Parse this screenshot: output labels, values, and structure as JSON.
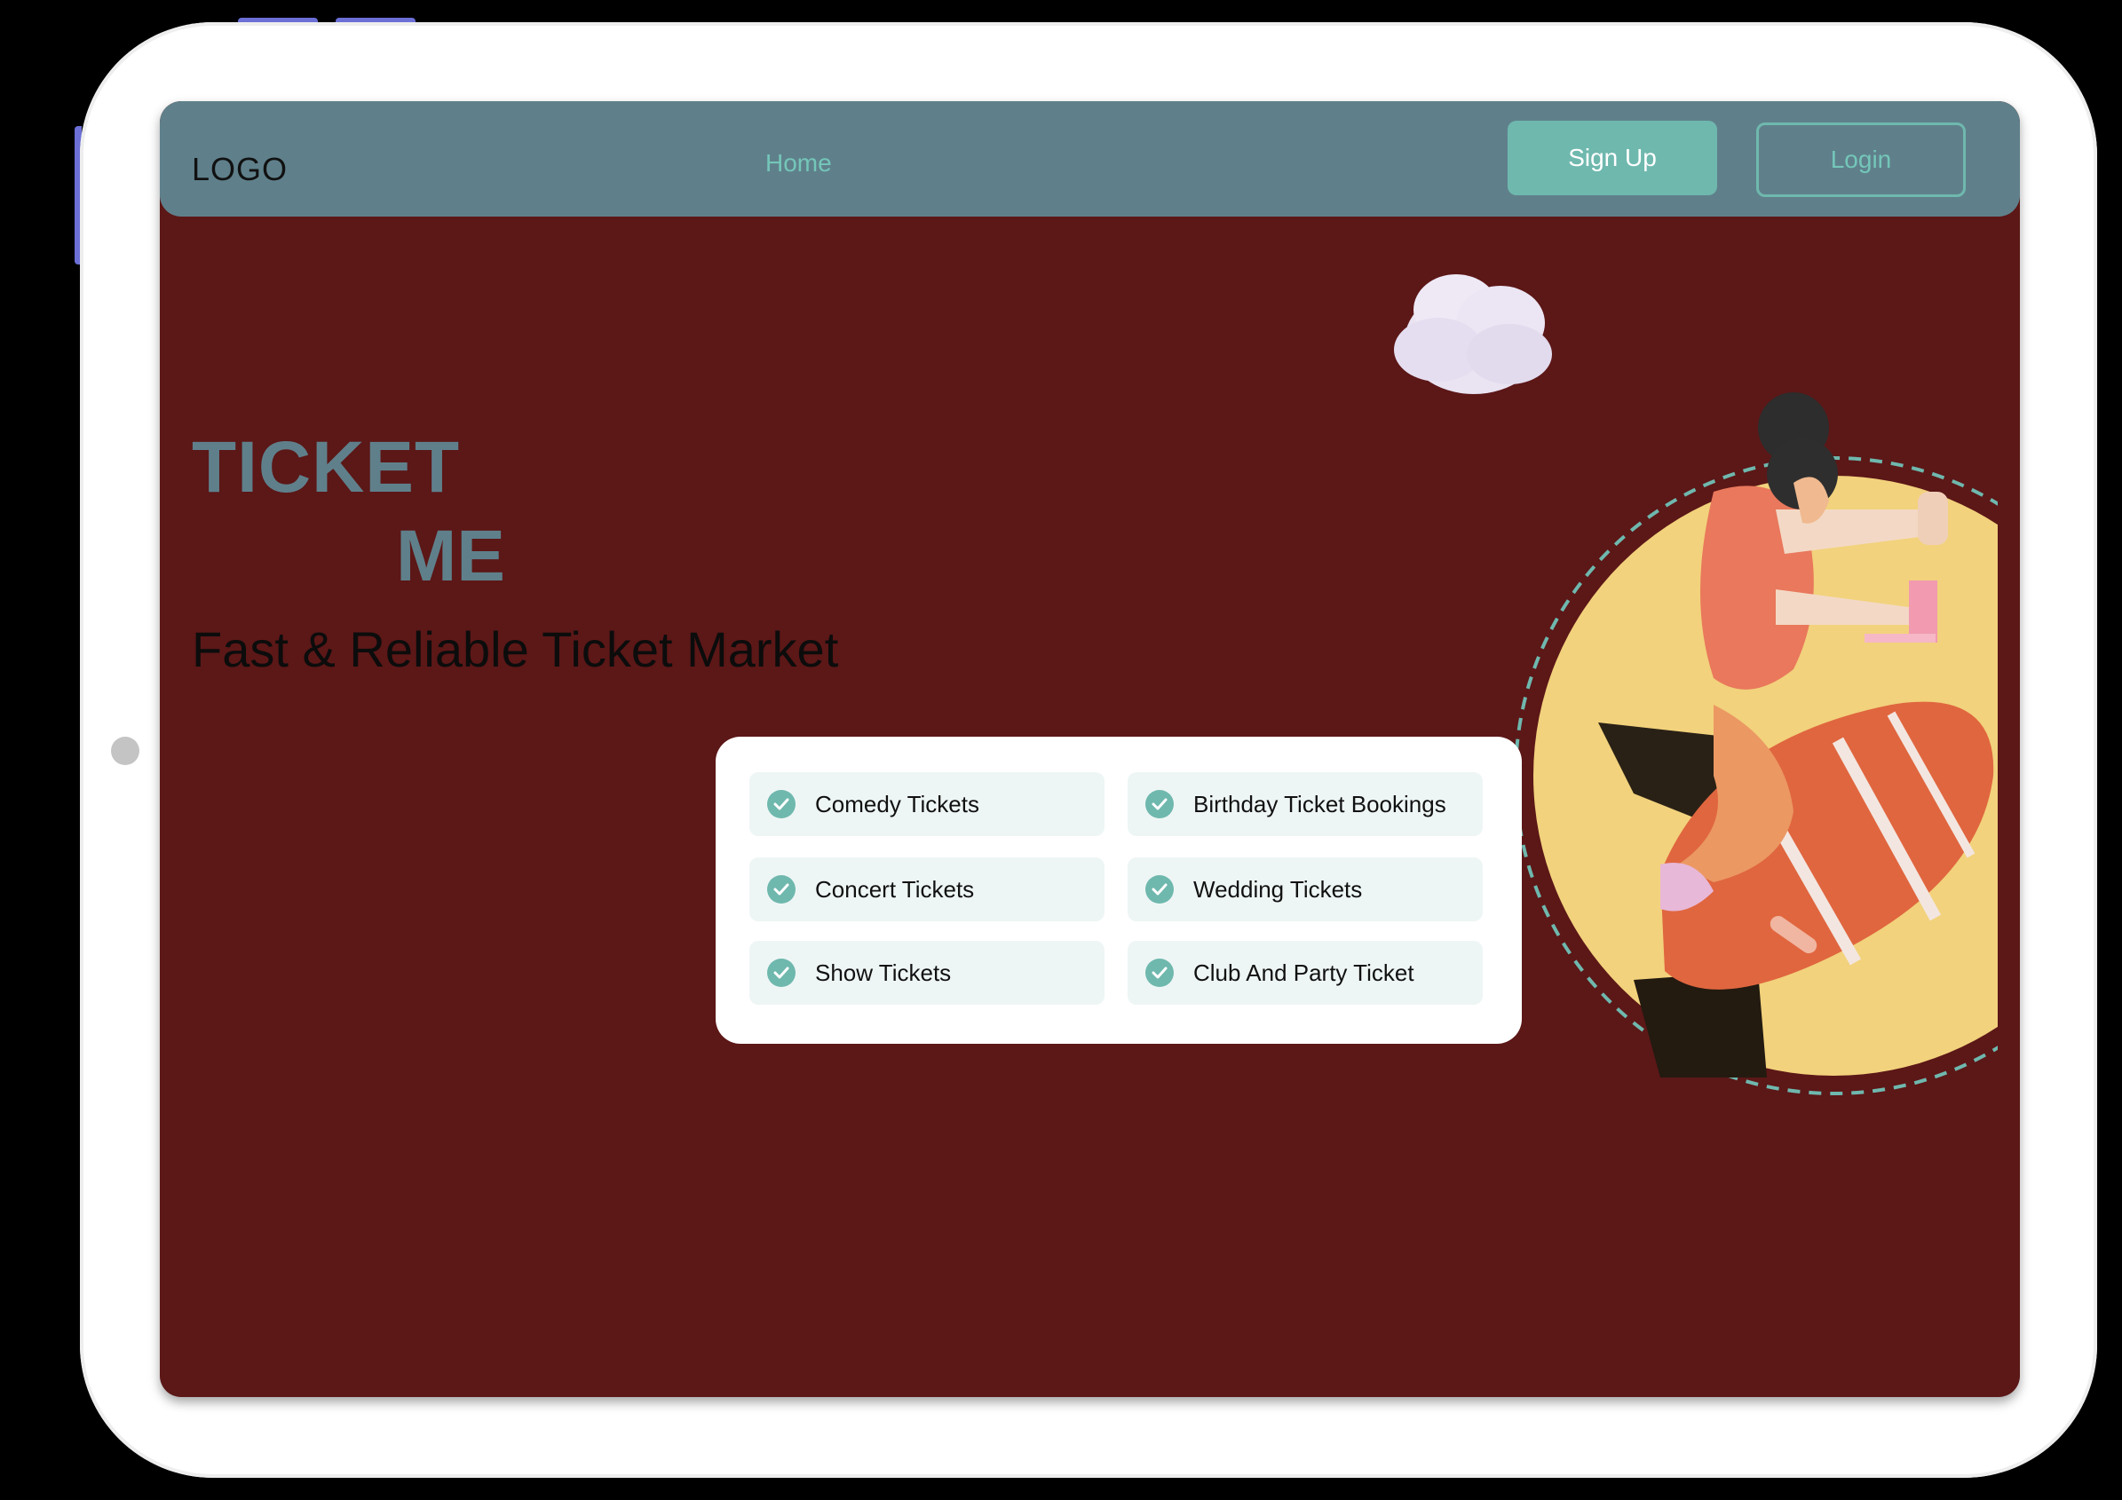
{
  "header": {
    "logo": "LOGO",
    "nav_home": "Home",
    "signup_label": "Sign Up",
    "login_label": "Login"
  },
  "hero": {
    "title_line1": "TICKET",
    "title_line2": "ME",
    "subtitle": "Fast & Reliable Ticket Market"
  },
  "categories": [
    "Comedy Tickets",
    "Birthday Ticket Bookings",
    "Concert Tickets",
    "Wedding Tickets",
    "Show Tickets",
    "Club And Party Ticket"
  ],
  "icons": {
    "check": "check-circle-icon",
    "cloud": "cloud-icon"
  },
  "colors": {
    "page_background": "#5c1717",
    "navbar": "#5f808b",
    "accent_teal": "#6fb8ae",
    "title": "#5f808b",
    "circle": "#f2d27c",
    "rocket": "#e0663f",
    "shirt": "#e9785c"
  }
}
